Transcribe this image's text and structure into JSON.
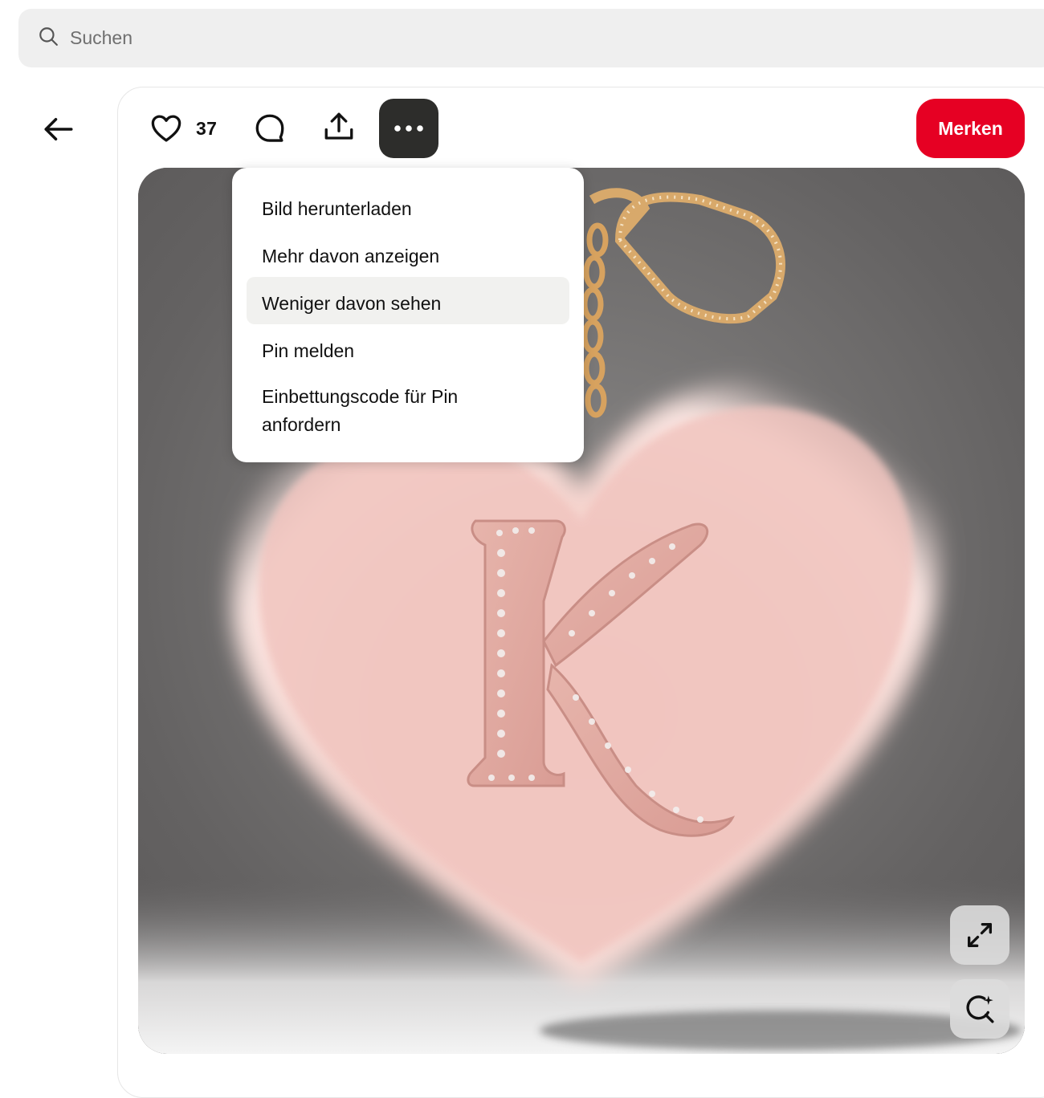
{
  "search": {
    "placeholder": "Suchen"
  },
  "pin": {
    "like_count": "37",
    "save_label": "Merken"
  },
  "menu": {
    "items": [
      {
        "label": "Bild herunterladen"
      },
      {
        "label": "Mehr davon anzeigen"
      },
      {
        "label": "Weniger davon sehen",
        "highlighted": true
      },
      {
        "label": "Pin melden"
      },
      {
        "label": "Einbettungscode für Pin anfordern"
      }
    ]
  },
  "colors": {
    "save_button": "#e60023",
    "more_button_active": "#2d2d2b",
    "search_background": "#efefef"
  },
  "icons": {
    "search": "search-icon",
    "back": "arrow-left-icon",
    "like": "heart-icon",
    "comment": "comment-icon",
    "share": "share-upload-icon",
    "more": "ellipsis-icon",
    "expand": "expand-icon",
    "visual_search": "visual-search-icon"
  }
}
